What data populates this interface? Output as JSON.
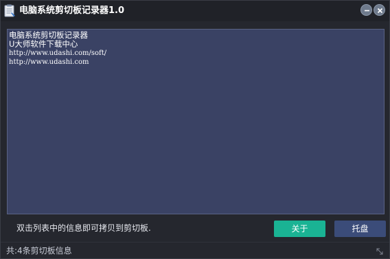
{
  "window": {
    "title": "电脑系统剪切板记录器1.0",
    "app_icon": "clipboard-icon",
    "minimize_icon": "minimize-icon",
    "close_icon": "close-icon"
  },
  "clipboard_list": {
    "items": [
      "电脑系统剪切板记录器",
      "U大师软件下载中心",
      "http://www.udashi.com/soft/",
      "http://www.udashi.com"
    ]
  },
  "footer": {
    "hint": "双击列表中的信息即可拷贝到剪切板.",
    "about_label": "关于",
    "tray_label": "托盘"
  },
  "statusbar": {
    "text": "共:4条剪切板信息",
    "grip_icon": "resize-grip-icon"
  },
  "colors": {
    "list_background": "#3a4264",
    "about_button": "#1ab394",
    "tray_button": "#3b4c79",
    "titlebar": "#202228"
  }
}
